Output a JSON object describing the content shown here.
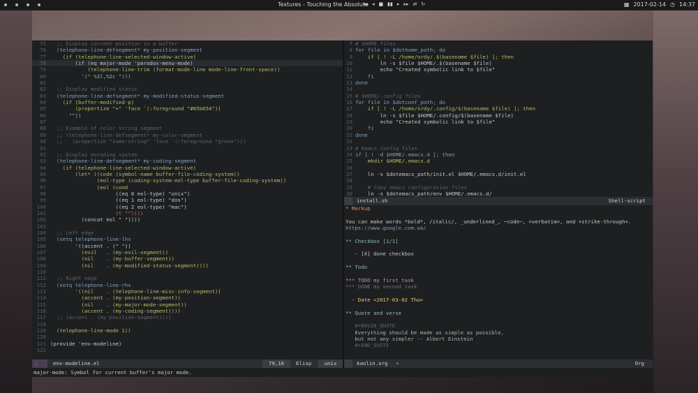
{
  "topbar": {
    "title": "Textures - Touching the Absolute",
    "controls": [
      "◂◂",
      "◂",
      "■",
      "▮▮",
      "▸",
      "▸▸",
      "⇄",
      "↻"
    ],
    "date": "2017-02-14",
    "time": "14:37"
  },
  "left_buffer": {
    "lines": [
      {
        "n": "75",
        "t": "  ;; Display current position in a buffer",
        "c": "#5f656b"
      },
      {
        "n": "76",
        "t": "  (telephone-line-defsegment* my-position-segment",
        "c": "#81a2be"
      },
      {
        "n": "77",
        "t": "    (if (telephone-line-selected-window-active)",
        "c": "#b5bd68"
      },
      {
        "n": "78",
        "t": "        (if (eq major-mode 'paradox-menu-mode)",
        "c": "#c5c8c6",
        "cur": true
      },
      {
        "n": "79",
        "t": "            (telephone-line-trim (format-mode-line mode-line-front-space))",
        "c": "#b5bd68"
      },
      {
        "n": "80",
        "t": "          '(\" %3l,%2c \")))",
        "c": "#8abeb7"
      },
      {
        "n": "81",
        "t": "",
        "c": "#c5c8c6"
      },
      {
        "n": "82",
        "t": "  ;; Display modified status",
        "c": "#5f656b"
      },
      {
        "n": "83",
        "t": "  (telephone-line-defsegment* my-modified-status-segment",
        "c": "#81a2be"
      },
      {
        "n": "84",
        "t": "    (if (buffer-modified-p)",
        "c": "#b5bd68"
      },
      {
        "n": "85",
        "t": "        (propertize \"+\" 'face `(:foreground \"#85b654\"))",
        "c": "#b5bd68"
      },
      {
        "n": "86",
        "t": "      \"\"))",
        "c": "#8abeb7"
      },
      {
        "n": "87",
        "t": "",
        "c": "#c5c8c6"
      },
      {
        "n": "88",
        "t": "  ;; Example of color string segment",
        "c": "#5f656b"
      },
      {
        "n": "89",
        "t": "  ;; (telephone-line-defsegment* my-color-segment",
        "c": "#5f656b"
      },
      {
        "n": "90",
        "t": "  ;;   (propertize \"some-string\" 'face `(:foreground \"green\")))",
        "c": "#5f656b"
      },
      {
        "n": "91",
        "t": "",
        "c": "#c5c8c6"
      },
      {
        "n": "92",
        "t": "  ;; Display encoding system",
        "c": "#5f656b"
      },
      {
        "n": "93",
        "t": "  (telephone-line-defsegment* my-coding-segment",
        "c": "#81a2be"
      },
      {
        "n": "94",
        "t": "    (if (telephone-line-selected-window-active)",
        "c": "#b5bd68"
      },
      {
        "n": "95",
        "t": "        (let* ((code (symbol-name buffer-file-coding-system))",
        "c": "#b5bd68"
      },
      {
        "n": "96",
        "t": "               (eol-type (coding-system-eol-type buffer-file-coding-system))",
        "c": "#b5bd68"
      },
      {
        "n": "97",
        "t": "               (eol (cond",
        "c": "#b5bd68"
      },
      {
        "n": "98",
        "t": "                     ((eq 0 eol-type) \"unix\")",
        "c": "#c5c8c6"
      },
      {
        "n": "99",
        "t": "                     ((eq 1 eol-type) \"dos\")",
        "c": "#c5c8c6"
      },
      {
        "n": "100",
        "t": "                     ((eq 2 eol-type) \"mac\")",
        "c": "#c5c8c6"
      },
      {
        "n": "101",
        "t": "                     (t \"\"))))",
        "c": "#cc6666"
      },
      {
        "n": "102",
        "t": "          (concat eol \" \"))))",
        "c": "#c5c8c6"
      },
      {
        "n": "103",
        "t": "",
        "c": "#c5c8c6"
      },
      {
        "n": "104",
        "t": "  ;; Left edge",
        "c": "#5f656b"
      },
      {
        "n": "105",
        "t": "  (setq telephone-line-lhs",
        "c": "#81a2be"
      },
      {
        "n": "106",
        "t": "        '((accent . (\" \"))",
        "c": "#c5c8c6"
      },
      {
        "n": "107",
        "t": "          (evil   . (my-evil-segment))",
        "c": "#b5bd68"
      },
      {
        "n": "108",
        "t": "          (nil    . (my-buffer-segment))",
        "c": "#b5bd68"
      },
      {
        "n": "109",
        "t": "          (nil    . (my-modified-status-segment))))",
        "c": "#b5bd68"
      },
      {
        "n": "110",
        "t": "",
        "c": "#c5c8c6"
      },
      {
        "n": "111",
        "t": "  ;; Right edge",
        "c": "#5f656b"
      },
      {
        "n": "112",
        "t": "  (setq telephone-line-rhs",
        "c": "#81a2be"
      },
      {
        "n": "113",
        "t": "        '((nil    . (telephone-line-misc-info-segment))",
        "c": "#b5bd68"
      },
      {
        "n": "114",
        "t": "          (accent . (my-position-segment))",
        "c": "#b5bd68"
      },
      {
        "n": "115",
        "t": "          (nil    . (my-major-mode-segment))",
        "c": "#b5bd68"
      },
      {
        "n": "116",
        "t": "          (accent . (my-coding-segment))))",
        "c": "#b5bd68"
      },
      {
        "n": "117",
        "t": "  ;; (accent . (my-position-segment))))",
        "c": "#5f656b"
      },
      {
        "n": "118",
        "t": "",
        "c": "#c5c8c6"
      },
      {
        "n": "119",
        "t": "  (telephone-line-mode 1))",
        "c": "#b5bd68"
      },
      {
        "n": "120",
        "t": "",
        "c": "#c5c8c6"
      },
      {
        "n": "121",
        "t": "(provide 'env-modeline)",
        "c": "#c5c8c6"
      },
      {
        "n": "122",
        "t": "",
        "c": "#c5c8c6"
      }
    ],
    "modeline": {
      "state": ":",
      "filename": "env-modeline.el",
      "position": "79,16",
      "mode": "Elisp",
      "encoding": "unix"
    }
  },
  "right_top_buffer": {
    "lines": [
      {
        "n": "7",
        "t": "# $HOME files",
        "c": "#5f656b"
      },
      {
        "n": "8",
        "t": "for file in $dothome_path; do",
        "c": "#81a2be"
      },
      {
        "n": "9",
        "t": "    if [ ! -L /home/ordy/.$(basename $file) ]; then",
        "c": "#b5bd68"
      },
      {
        "n": "10",
        "t": "        ln -s $file $HOME/.$(basename $file)",
        "c": "#c5c8c6"
      },
      {
        "n": "11",
        "t": "        echo \"Created symbolic link to $file\"",
        "c": "#c5c8c6"
      },
      {
        "n": "12",
        "t": "    fi",
        "c": "#81a2be"
      },
      {
        "n": "13",
        "t": "done",
        "c": "#81a2be"
      },
      {
        "n": "14",
        "t": "",
        "c": "#c5c8c6"
      },
      {
        "n": "15",
        "t": "# $HOME/.config files",
        "c": "#5f656b"
      },
      {
        "n": "16",
        "t": "for file in $dotconf_path; do",
        "c": "#81a2be"
      },
      {
        "n": "17",
        "t": "    if [ ! -L /home/ordy/.config/$(basename $file) ]; then",
        "c": "#b5bd68"
      },
      {
        "n": "18",
        "t": "        ln -s $file $HOME/.config/$(basename $file)",
        "c": "#c5c8c6"
      },
      {
        "n": "19",
        "t": "        echo \"Created symbolic link to $file\"",
        "c": "#c5c8c6"
      },
      {
        "n": "20",
        "t": "    fi",
        "c": "#81a2be"
      },
      {
        "n": "21",
        "t": "done",
        "c": "#81a2be"
      },
      {
        "n": "22",
        "t": "",
        "c": "#c5c8c6"
      },
      {
        "n": "23",
        "t": "# Emacs config files",
        "c": "#5f656b"
      },
      {
        "n": "24",
        "t": "if [ ! -d $HOME/.emacs.d ]; then",
        "c": "#81a2be"
      },
      {
        "n": "25",
        "t": "    mkdir $HOME/.emacs.d",
        "c": "#b5bd68"
      },
      {
        "n": "26",
        "t": "",
        "c": "#c5c8c6"
      },
      {
        "n": "27",
        "t": "    ln -s $dotemacs_path/init.el $HOME/.emacs.d/init.el",
        "c": "#c5c8c6"
      },
      {
        "n": "28",
        "t": "",
        "c": "#c5c8c6"
      },
      {
        "n": "29",
        "t": "    # Copy emacs configuration files",
        "c": "#5f656b"
      },
      {
        "n": "30",
        "t": "    ln -s $dotemacs_path/env $HOME/.emacs.d/",
        "c": "#c5c8c6"
      }
    ],
    "modeline": {
      "filename": "install.sh",
      "mode": "Shell-script"
    }
  },
  "right_bottom_buffer": {
    "lines": [
      {
        "t": "* Markup",
        "c": "#de935f"
      },
      {
        "t": "",
        "c": "#c5c8c6"
      },
      {
        "t": "You can make words *bold*, /italic/, _underlined_, ~code~, =verbatim=, and +strike-through+.",
        "c": "#c5c8c6"
      },
      {
        "t": "https://www.google.com.ua/",
        "c": "#81a2be"
      },
      {
        "t": "",
        "c": "#c5c8c6"
      },
      {
        "t": "** Checkbox [1/1]",
        "c": "#8abeb7"
      },
      {
        "t": "",
        "c": "#c5c8c6"
      },
      {
        "t": "   - [X] done checkbox",
        "c": "#c5c8c6"
      },
      {
        "t": "",
        "c": "#c5c8c6"
      },
      {
        "t": "** Todo",
        "c": "#8abeb7"
      },
      {
        "t": "",
        "c": "#c5c8c6"
      },
      {
        "t": "*** TODO my first task",
        "c": "#b294bb"
      },
      {
        "t": "*** DONE my second task",
        "c": "#6f7478"
      },
      {
        "t": "",
        "c": "#c5c8c6"
      },
      {
        "t": "  - Date <2017-03-02 Thu>",
        "c": "#f0c674"
      },
      {
        "t": "",
        "c": "#c5c8c6"
      },
      {
        "t": "** Quote and verse",
        "c": "#8abeb7"
      },
      {
        "t": "",
        "c": "#c5c8c6"
      },
      {
        "t": "   #+BEGIN_QUOTE",
        "c": "#5f656b"
      },
      {
        "t": "   Everything should be made as simple as possible,",
        "c": "#b0b3b0"
      },
      {
        "t": "   but not any simpler -- Albert Einstein",
        "c": "#b0b3b0"
      },
      {
        "t": "   #+END_QUOTE",
        "c": "#5f656b"
      }
    ],
    "modeline": {
      "filename": "kaolin.org",
      "modified": "+",
      "mode": "Org"
    }
  },
  "echo_area": {
    "text": "major-mode: Symbol for current buffer's major mode."
  },
  "colors": {
    "background": "#1d1f21",
    "modeline_bg": "#2c2f32",
    "accent": "#c9a8e8"
  }
}
